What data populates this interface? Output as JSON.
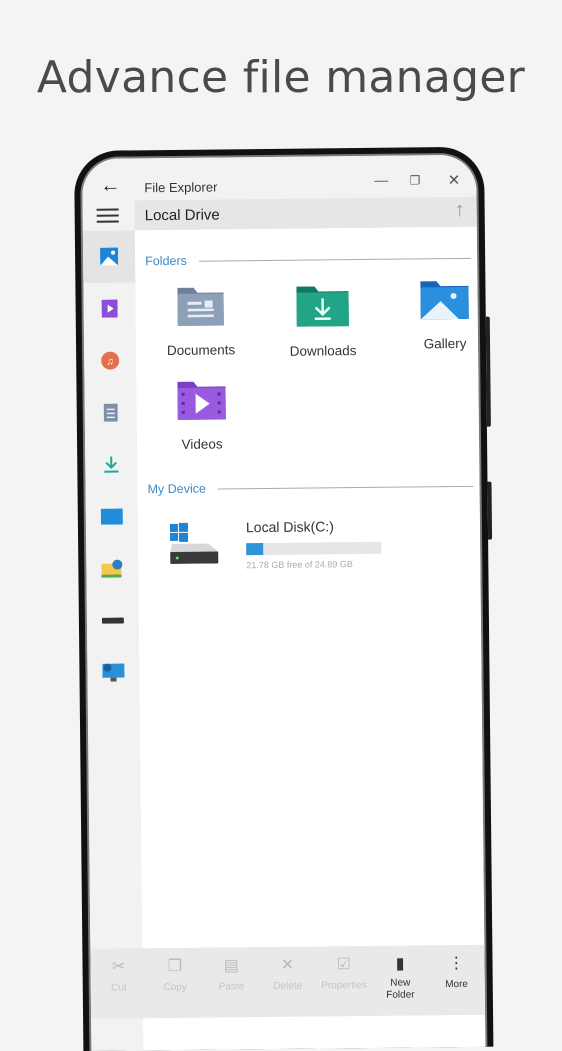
{
  "headline": "Advance file manager",
  "window": {
    "title": "File Explorer",
    "back_icon": "arrow-left-icon",
    "minimize": "—",
    "maximize": "❐",
    "close": "✕"
  },
  "address": {
    "path": "Local Drive",
    "up_icon": "↑"
  },
  "sidebar": {
    "items": [
      {
        "name": "gallery",
        "icon": "image-icon",
        "active": true
      },
      {
        "name": "videos",
        "icon": "video-icon"
      },
      {
        "name": "music",
        "icon": "music-icon"
      },
      {
        "name": "documents",
        "icon": "document-icon"
      },
      {
        "name": "downloads",
        "icon": "download-icon"
      },
      {
        "name": "desktop",
        "icon": "desktop-icon"
      },
      {
        "name": "network",
        "icon": "network-folder-icon"
      },
      {
        "name": "drive",
        "icon": "drive-icon"
      },
      {
        "name": "remote",
        "icon": "remote-computer-icon"
      }
    ]
  },
  "folders": {
    "heading": "Folders",
    "items": [
      {
        "label": "Documents",
        "icon": "documents-folder-icon"
      },
      {
        "label": "Downloads",
        "icon": "downloads-folder-icon"
      },
      {
        "label": "Gallery",
        "icon": "gallery-folder-icon"
      },
      {
        "label": "Videos",
        "icon": "videos-folder-icon"
      }
    ]
  },
  "device": {
    "heading": "My Device",
    "drive": {
      "name": "Local Disk(C:)",
      "free_text": "21.78 GB free of 24.89 GB",
      "used_percent": 12.5,
      "accent": "#2f95d8"
    }
  },
  "bottombar": {
    "items": [
      {
        "label": "Cut",
        "icon": "✂",
        "enabled": false
      },
      {
        "label": "Copy",
        "icon": "❐",
        "enabled": false
      },
      {
        "label": "Paste",
        "icon": "▤",
        "enabled": false
      },
      {
        "label": "Delete",
        "icon": "✕",
        "enabled": false
      },
      {
        "label": "Properties",
        "icon": "☑",
        "enabled": false
      },
      {
        "label": "New Folder",
        "icon": "▮",
        "enabled": true
      },
      {
        "label": "More",
        "icon": "⋮",
        "enabled": true
      }
    ]
  }
}
